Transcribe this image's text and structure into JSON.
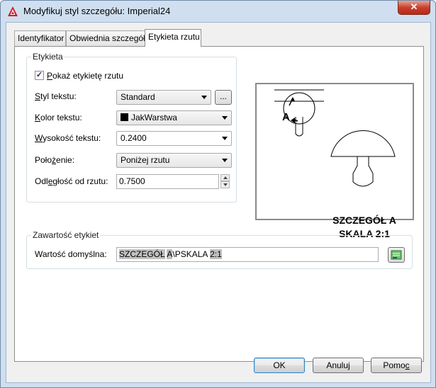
{
  "window": {
    "title": "Modyfikuj styl szczegółu: Imperial24",
    "close_glyph": "✕",
    "app_icon": "autocad-logo-icon"
  },
  "tabs": [
    {
      "label": "Identyfikator",
      "active": false
    },
    {
      "label": "Obwiednia szczegółu",
      "active": false
    },
    {
      "label": "Etykieta rzutu",
      "active": true
    }
  ],
  "etykieta": {
    "group_title": "Etykieta",
    "show_label": {
      "label_u": "P",
      "label_rest": "okaż etykietę rzutu",
      "checked": true,
      "check_glyph": "✓"
    },
    "text_style": {
      "label_u": "S",
      "label_rest": "tyl tekstu:",
      "value": "Standard",
      "browse_label": "..."
    },
    "text_color": {
      "label_u": "K",
      "label_rest": "olor tekstu:",
      "value": "JakWarstwa",
      "swatch": "#000000"
    },
    "text_height": {
      "label_u": "W",
      "label_rest": "ysokość tekstu:",
      "value": "0.2400"
    },
    "position": {
      "label_pre": "Poło",
      "label_u": "ż",
      "label_rest": "enie:",
      "value": "Poniżej rzutu"
    },
    "offset": {
      "label_pre": "Odl",
      "label_u": "e",
      "label_rest": "głość od rzutu:",
      "value": "0.7500"
    }
  },
  "preview": {
    "line1": "SZCZEGÓŁ A",
    "line2": "SKALA 2:1",
    "bubble_letter": "A"
  },
  "contents": {
    "group_title": "Zawartość etykiet",
    "default_label": "Wartość domyślna:",
    "value_parts": [
      "SZCZEGÓŁ",
      " ",
      "A",
      "\\PSKALA ",
      "2:1"
    ]
  },
  "footer": {
    "ok": "OK",
    "cancel": "Anuluj",
    "help_pre": "Pomo",
    "help_u": "c"
  }
}
